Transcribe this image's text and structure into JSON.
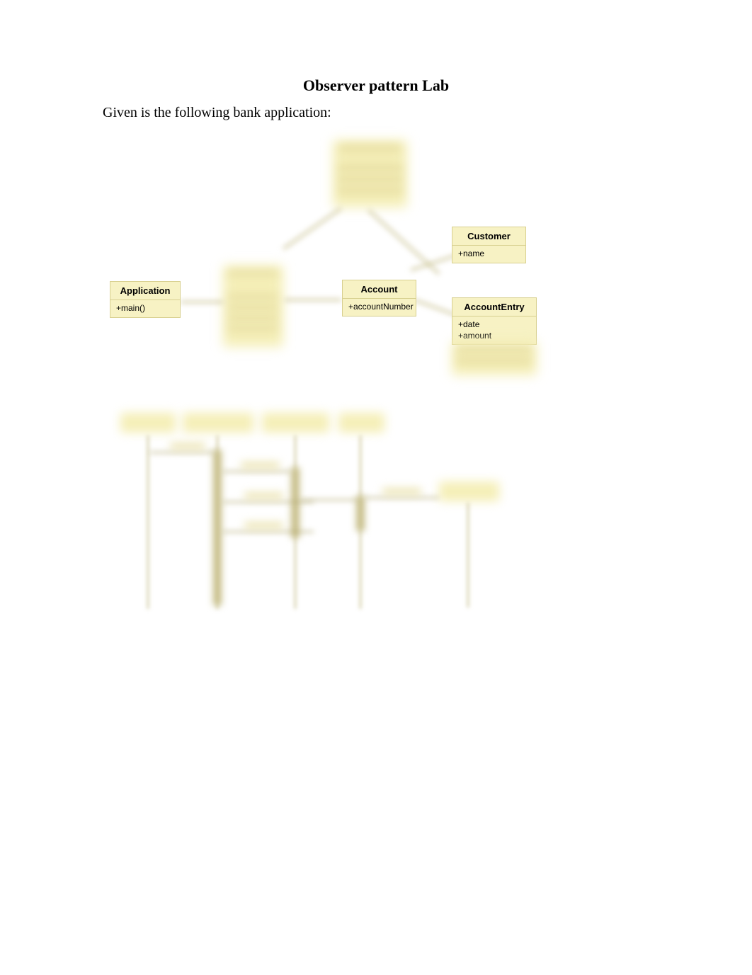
{
  "title": "Observer pattern Lab",
  "intro": "Given is the following bank application:",
  "classes": {
    "application": {
      "name": "Application",
      "methods": [
        "+main()"
      ]
    },
    "account": {
      "name": "Account",
      "attributes": [
        "+accountNumber"
      ]
    },
    "customer": {
      "name": "Customer",
      "attributes": [
        "+name"
      ]
    },
    "accountEntry": {
      "name": "AccountEntry",
      "attributes": [
        "+date",
        "+amount"
      ]
    }
  }
}
